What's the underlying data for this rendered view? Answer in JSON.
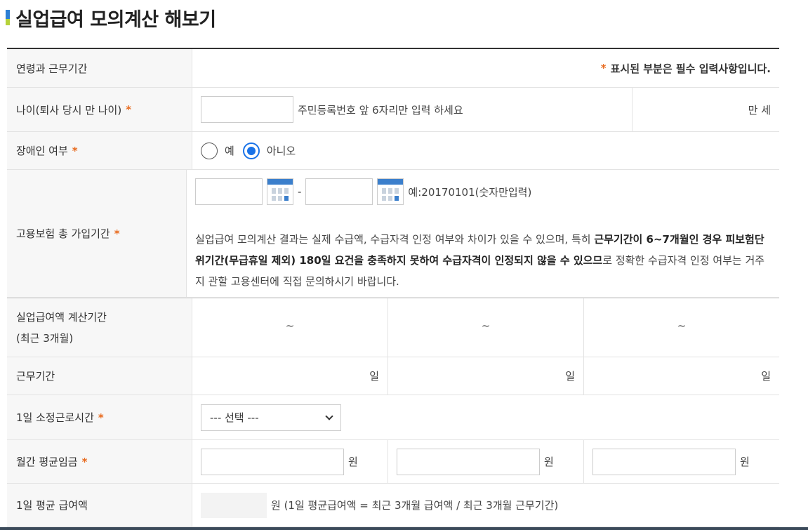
{
  "page": {
    "title": "실업급여 모의계산 해보기"
  },
  "header_row": {
    "label": "연령과 근무기간",
    "required_note_star": "*",
    "required_note": "표시된 부분은 필수 입력사항입니다."
  },
  "age": {
    "label": "나이(퇴사 당시 만 나이)",
    "star": "*",
    "hint": "주민등록번호 앞 6자리만 입력 하세요",
    "unit": "만 세",
    "value": ""
  },
  "disability": {
    "label": "장애인 여부",
    "star": "*",
    "options": [
      {
        "label": "예",
        "selected": false
      },
      {
        "label": "아니오",
        "selected": true
      }
    ]
  },
  "insurance": {
    "label": "고용보험 총 가입기간",
    "star": "*",
    "start_value": "",
    "end_value": "",
    "dash": "-",
    "date_hint": "예:20170101(숫자만입력)",
    "note_parts": [
      "실업급여 모의계산 결과는 실제 수급액, 수급자격 인정 여부와 차이가 있을 수 있으며, 특히 ",
      "근무기간이 6~7개월인 경우 피보험단위기간(무급휴일 제외) 180일 요건을 충족하지 못하여 수급자격이 인정되지 않을 수 있으므",
      "로 정확한 수급자격 인정 여부는 거주지 관할 고용센터에 직접 문의하시기 바랍니다."
    ]
  },
  "calc_period": {
    "label_line1": "실업급여액 계산기간",
    "label_line2": "(최근 3개월)",
    "values": [
      "~",
      "~",
      "~"
    ]
  },
  "work_period": {
    "label": "근무기간",
    "units": [
      "일",
      "일",
      "일"
    ]
  },
  "daily_hours": {
    "label": "1일 소정근로시간",
    "star": "*",
    "selected": "--- 선택 ---"
  },
  "monthly_wage": {
    "label": "월간 평균임금",
    "star": "*",
    "units": [
      "원",
      "원",
      "원"
    ]
  },
  "daily_avg": {
    "label": "1일 평균 급여액",
    "value": "",
    "formula": "원 (1일 평균급여액 = 최근 3개월 급여액 / 최근 3개월 근무기간)"
  },
  "colors": {
    "accent": "#1a73e8",
    "required": "#e86b1f",
    "title_mark_top": "#2d7ed3",
    "title_mark_bottom": "#b6d23a"
  },
  "icons": {
    "calendar": "calendar-icon",
    "dropdown": "chevron-down-icon"
  }
}
